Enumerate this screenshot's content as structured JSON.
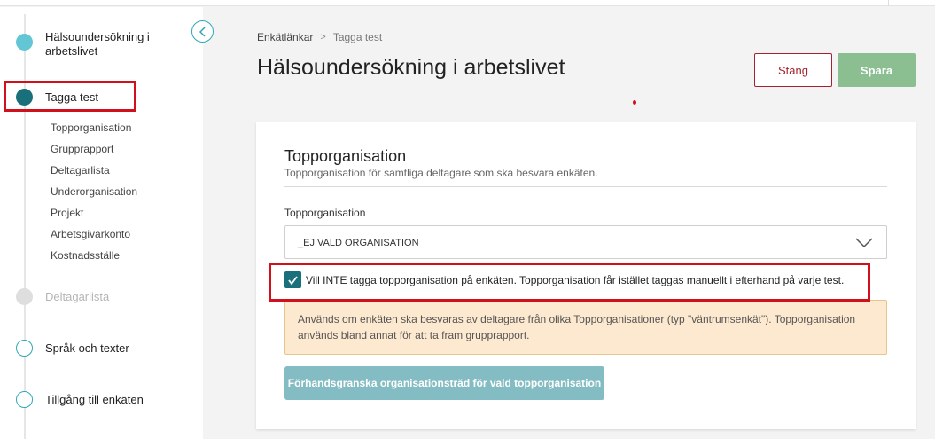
{
  "sidebar": {
    "steps": [
      {
        "label": "Hälsoundersökning i arbetslivet",
        "state": "done"
      },
      {
        "label": "Tagga test",
        "state": "active"
      },
      {
        "label": "Deltagarlista",
        "state": "disabled"
      },
      {
        "label": "Språk och texter",
        "state": "todo"
      },
      {
        "label": "Tillgång till enkäten",
        "state": "todo"
      }
    ],
    "substeps": [
      "Topporganisation",
      "Grupprapport",
      "Deltagarlista",
      "Underorganisation",
      "Projekt",
      "Arbetsgivarkonto",
      "Kostnadsställe"
    ]
  },
  "breadcrumb": {
    "parent": "Enkätlänkar",
    "separator": ">",
    "current": "Tagga test"
  },
  "page": {
    "title": "Hälsoundersökning i arbetslivet"
  },
  "toolbar": {
    "close_label": "Stäng",
    "save_label": "Spara"
  },
  "card": {
    "title": "Topporganisation",
    "subtitle": "Topporganisation för samtliga deltagare som ska besvara enkäten.",
    "field_label": "Topporganisation",
    "select_value": "_EJ VALD ORGANISATION",
    "checkbox_checked": true,
    "checkbox_label": "Vill INTE tagga topporganisation på enkäten. Topporganisation får istället taggas manuellt i efterhand på varje test.",
    "info_text": "Används om enkäten ska besvaras av deltagare från olika Topporganisationer (typ \"väntrumsenkät\"). Topporganisation används bland annat för att ta fram grupprapport.",
    "preview_button": "Förhandsgranska organisationsträd för vald topporganisation"
  },
  "colors": {
    "accent": "#19707a",
    "accent_light": "#63c6d4",
    "danger": "#a3222f",
    "save": "#8bbf92",
    "warning_bg": "#fde9cf",
    "highlight": "#d0111b"
  },
  "icons": {
    "collapse": "chevron-left-icon",
    "select": "chevron-down-icon",
    "check": "check-icon"
  }
}
